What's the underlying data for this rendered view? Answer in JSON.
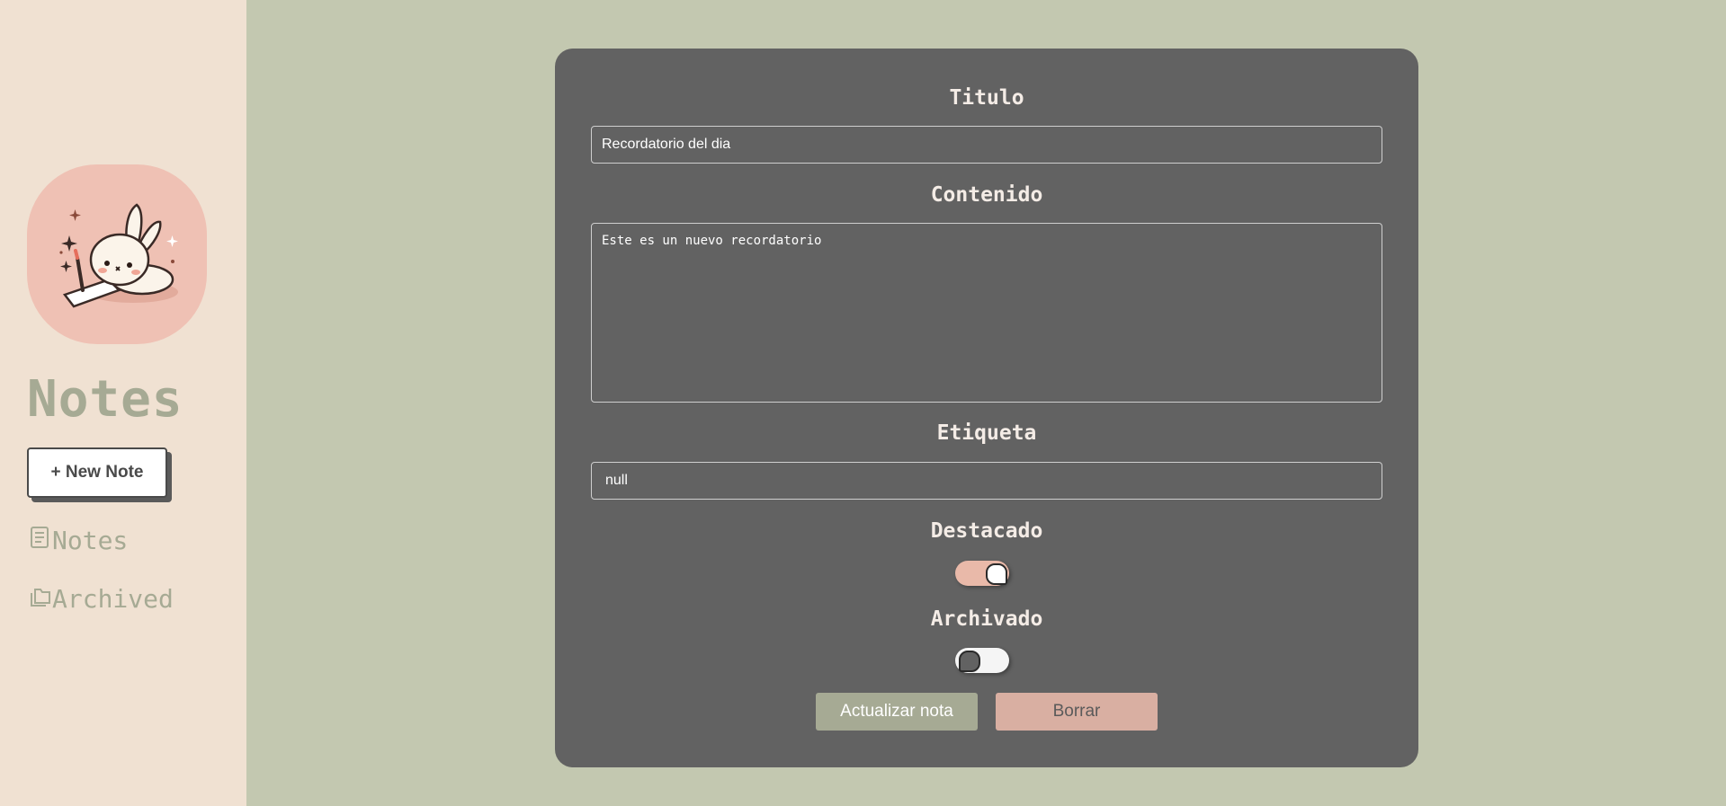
{
  "sidebar": {
    "logo_icon": "bunny-writing-icon",
    "app_title": "Notes",
    "new_note_label": "+ New Note",
    "nav": [
      {
        "label": "Notes",
        "icon": "note-icon"
      },
      {
        "label": "Archived",
        "icon": "folders-icon"
      }
    ]
  },
  "form": {
    "title_label": "Titulo",
    "title_value": "Recordatorio del dia",
    "content_label": "Contenido",
    "content_value": "Este es un nuevo recordatorio",
    "tag_label": "Etiqueta",
    "tag_value": "null",
    "featured_label": "Destacado",
    "featured_on": true,
    "archived_label": "Archivado",
    "archived_on": false,
    "update_label": "Actualizar nota",
    "delete_label": "Borrar"
  },
  "colors": {
    "background": "#c3c8b0",
    "sidebar": "#f0e1d2",
    "card": "#626262",
    "accent_green": "#a6aa94",
    "accent_pink": "#e9b9a9"
  }
}
